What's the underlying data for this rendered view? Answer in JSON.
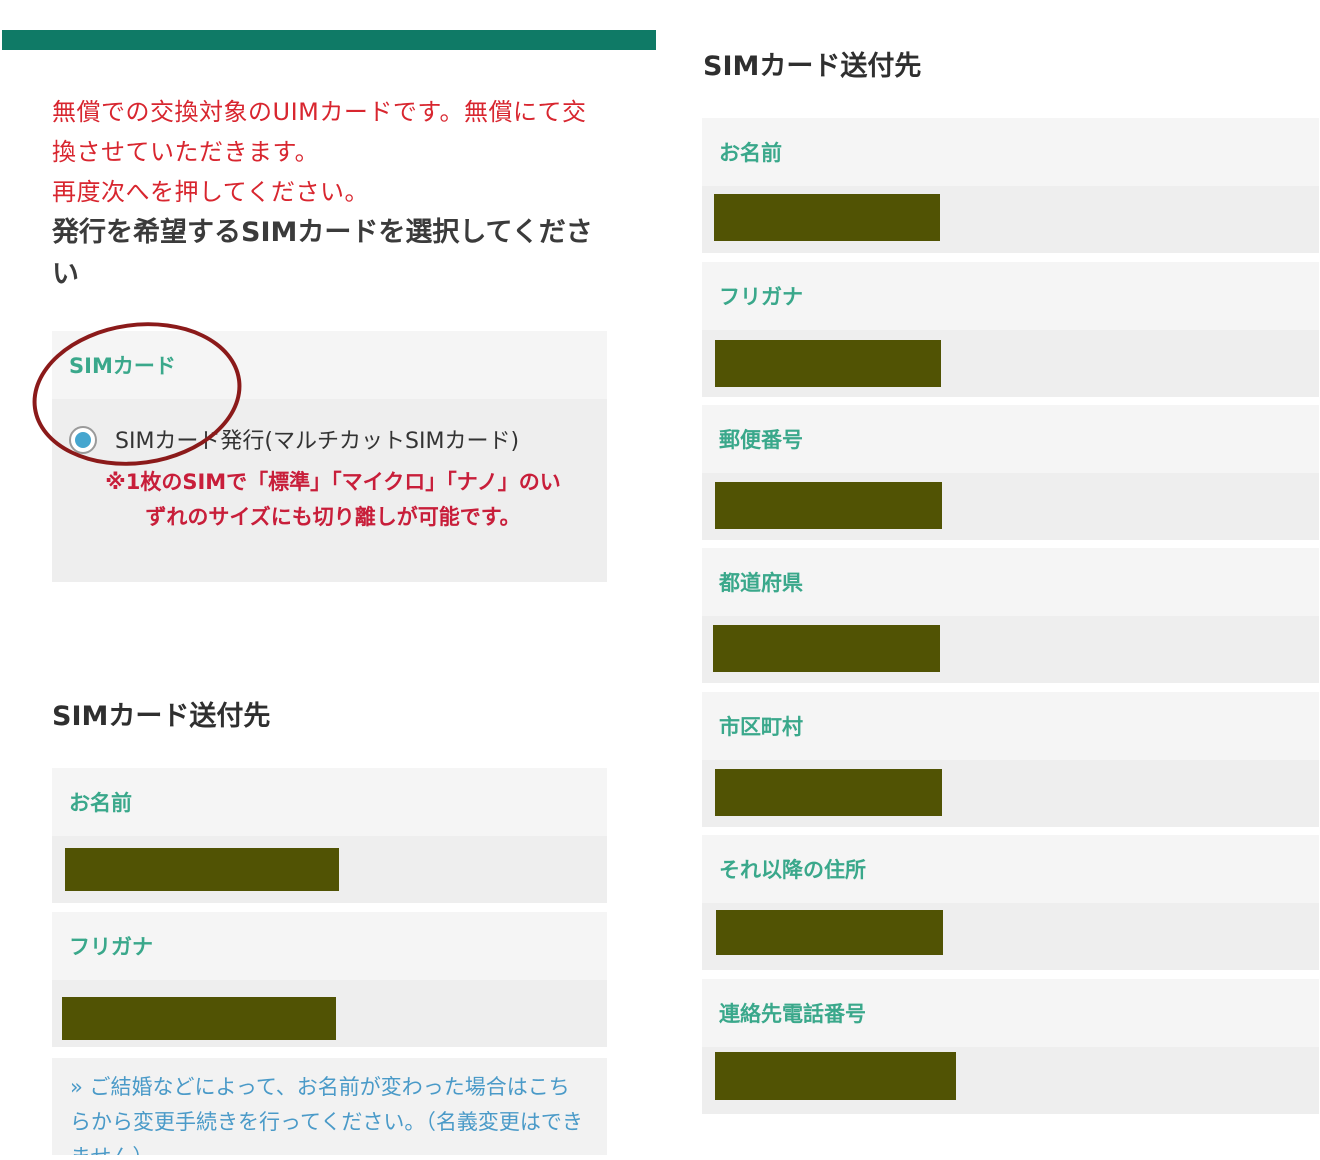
{
  "left": {
    "notice_line1": "無償での交換対象のUIMカードです。無償にて交",
    "notice_line2": "換させていただきます。",
    "notice_line3": "再度次へを押してください。",
    "select_heading": "発行を希望するSIMカードを選択してくださ い",
    "sim_panel": {
      "label": "SIMカード",
      "option_label": "SIMカード発行(マルチカットSIMカード)",
      "option_selected": true,
      "note_line1": "※1枚のSIMで「標準」「マイクロ」「ナノ」のい",
      "note_line2": "ずれのサイズにも切り離しが可能です。"
    },
    "shipping_title": "SIMカード送付先",
    "fields": [
      {
        "label": "お名前"
      },
      {
        "label": "フリガナ"
      }
    ],
    "link_note": "» ご結婚などによって、お名前が変わった場合はこちらから変更手続きを行ってください。（名義変更はできません）"
  },
  "right": {
    "shipping_title": "SIMカード送付先",
    "fields": [
      {
        "label": "お名前"
      },
      {
        "label": "フリガナ"
      },
      {
        "label": "郵便番号"
      },
      {
        "label": "都道府県"
      },
      {
        "label": "市区町村"
      },
      {
        "label": "それ以降の住所"
      },
      {
        "label": "連絡先電話番号"
      }
    ]
  },
  "colors": {
    "accent": "#0f7a66",
    "label_green": "#3aa88b",
    "notice_red": "#d8262f",
    "annotation": "#8b1a1a",
    "redaction": "#515304",
    "radio_fill": "#46a6cf",
    "link": "#4a9ac8"
  }
}
